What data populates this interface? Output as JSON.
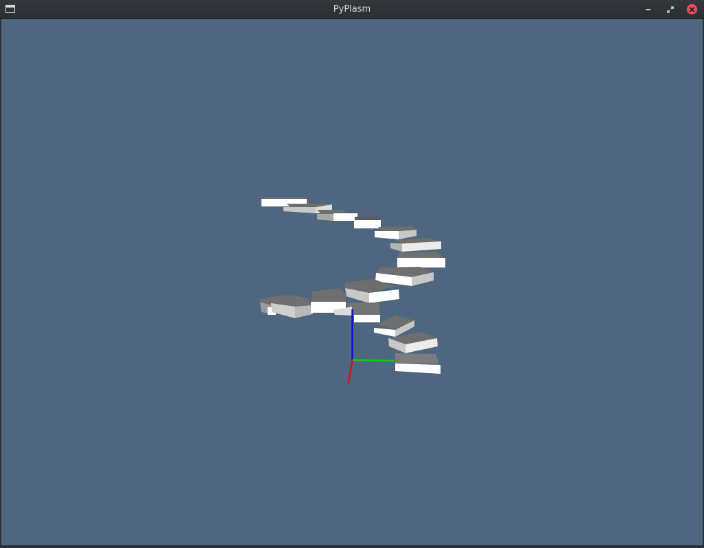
{
  "window": {
    "title": "PyPlasm",
    "icons": {
      "app": "window-app-icon",
      "minimize": "minimize-icon",
      "maximize": "maximize-icon",
      "close": "close-icon"
    }
  },
  "viewport": {
    "background": "#4e667f",
    "content": "spiral-staircase-3d-model",
    "axes": {
      "x_color": "#dd1111",
      "y_color": "#11cc11",
      "z_color": "#1111cc"
    }
  },
  "colors": {
    "step_front": "#ffffff",
    "step_side": "#c8c8c8",
    "step_top": "#6e6e6e",
    "close_button": "#e8535b"
  }
}
